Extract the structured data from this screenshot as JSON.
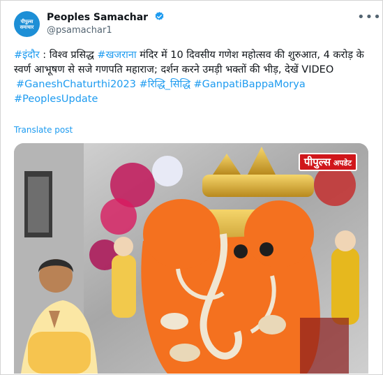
{
  "account": {
    "avatar_line1": "पीपुल्स",
    "avatar_line2": "समाचार",
    "name": "Peoples Samachar",
    "handle": "@psamachar1"
  },
  "icons": [
    "verified-badge-icon",
    "more-options-icon"
  ],
  "tweet": {
    "tag_indore": "#इंदौर",
    "sep": " :  विश्व प्रसिद्ध ",
    "tag_khajrana": "#खजराना",
    "text_main": " मंदिर में 10 दिवसीय गणेश महोत्सव की शुरुआत, 4 करोड़ के स्वर्ण आभूषण से सजे गणपति महाराज; दर्शन करने उमड़ी भक्तों की भीड़, देखें VIDEO",
    "hashtags": [
      "#GaneshChaturthi2023",
      "#रिद्धि_सिद्धि",
      "#GanpatiBappaMorya",
      "#PeoplesUpdate"
    ]
  },
  "translate_label": "Translate post",
  "media": {
    "badge_main": "पीपुल्स",
    "badge_sub": "अपडेट"
  },
  "colors": {
    "link": "#1d9bf0",
    "brand_red": "#d0161b",
    "idol_orange": "#f4711f"
  }
}
